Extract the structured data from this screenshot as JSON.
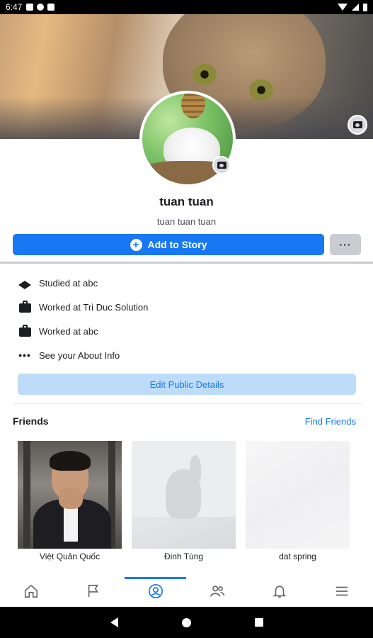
{
  "status_bar": {
    "time": "6:47"
  },
  "profile": {
    "name": "tuan tuan",
    "subname": "tuan tuan tuan",
    "add_story_label": "Add to Story",
    "more_label": "···"
  },
  "details": [
    {
      "icon": "graduation-cap-icon",
      "text": "Studied at abc"
    },
    {
      "icon": "briefcase-icon",
      "text": "Worked at Tri Duc Solution"
    },
    {
      "icon": "briefcase-icon",
      "text": "Worked at abc"
    },
    {
      "icon": "more-dots-icon",
      "text": "See your About Info"
    }
  ],
  "edit_public_label": "Edit Public Details",
  "friends": {
    "title": "Friends",
    "find_label": "Find Friends",
    "items": [
      {
        "name": "Việt Quản Quốc"
      },
      {
        "name": "Đinh Tùng"
      },
      {
        "name": "dat spring"
      }
    ]
  },
  "bottom_nav": [
    {
      "icon": "home-icon",
      "active": false
    },
    {
      "icon": "flag-icon",
      "active": false
    },
    {
      "icon": "profile-icon",
      "active": true
    },
    {
      "icon": "friends-icon",
      "active": false
    },
    {
      "icon": "bell-icon",
      "active": false
    },
    {
      "icon": "menu-icon",
      "active": false
    }
  ],
  "colors": {
    "accent": "#1877f2",
    "accent_light": "#bcdcfa",
    "text": "#1c1e21",
    "muted": "#4b4f56"
  }
}
